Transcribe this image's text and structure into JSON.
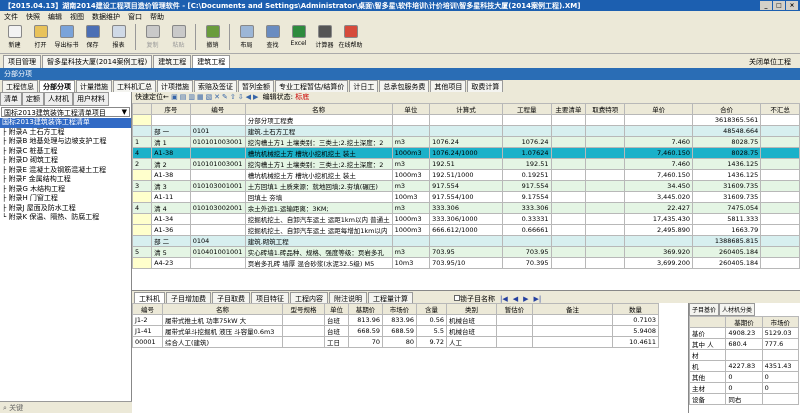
{
  "title": "【2015.04.13】湖南2014建设工程项目造价管理软件 - [C:\\Documents and Settings\\Administrator\\桌面\\智多星\\软件培训\\计价培训\\智多星科技大厦(2014案例工程).XM]",
  "window_controls": [
    "_",
    "□",
    "×"
  ],
  "menu": [
    "文件",
    "快照",
    "编辑",
    "视图",
    "数据维护",
    "窗口",
    "帮助"
  ],
  "toolbar": [
    {
      "label": "新建",
      "icon": "new-file-icon",
      "color": "#f3f3f3",
      "dis": false
    },
    {
      "label": "打开",
      "icon": "open-folder-icon",
      "color": "#e8c25a",
      "dis": false
    },
    {
      "label": "导出标书",
      "icon": "export-icon",
      "color": "#7aa3d9",
      "dis": false
    },
    {
      "label": "保存",
      "icon": "save-icon",
      "color": "#4b6fb5",
      "dis": false
    },
    {
      "label": "报表",
      "icon": "report-icon",
      "color": "#cfd9e6",
      "dis": false
    },
    {
      "label": "复制",
      "icon": "copy-icon",
      "color": "#c9c9c9",
      "dis": true
    },
    {
      "label": "粘贴",
      "icon": "paste-icon",
      "color": "#c9c9c9",
      "dis": true
    },
    {
      "label": "撤销",
      "icon": "undo-icon",
      "color": "#6a9c3c",
      "dis": false
    },
    {
      "label": "布局",
      "icon": "layout-icon",
      "color": "#9cb6d6",
      "dis": false
    },
    {
      "label": "查找",
      "icon": "find-icon",
      "color": "#6a8cc0",
      "dis": false
    },
    {
      "label": "Excel",
      "icon": "excel-icon",
      "color": "#2e8b3e",
      "dis": false
    },
    {
      "label": "计算器",
      "icon": "calculator-icon",
      "color": "#555",
      "dis": false
    },
    {
      "label": "在线帮助",
      "icon": "online-help-icon",
      "color": "#d64a3b",
      "dis": false
    }
  ],
  "top_tabs": [
    "项目管理",
    "智多星科技大厦(2014案例工程)",
    "建筑工程",
    "建筑工程"
  ],
  "top_right": [
    "关闭单位工程"
  ],
  "breadcrumb": "分部分项",
  "module_tabs": [
    "工程信息",
    "分部分项",
    "计量措施",
    "工料机汇总",
    "计项措施",
    "索赔及签证",
    "暂列金额",
    "专业工程暂估/结算价",
    "计日工",
    "总承包服务费",
    "其他项目",
    "取费计算"
  ],
  "left": {
    "tabs": [
      "清单",
      "定额",
      "人材机",
      "用户材料"
    ],
    "combo": "国标2013建筑装饰工程清单项目",
    "tree": [
      "国标2013建筑装饰工程清单",
      "├ 附录A 土石方工程",
      "├ 附录B 地基处理与边坡支护工程",
      "├ 附录C 桩基工程",
      "├ 附录D 砌筑工程",
      "├ 附录E 混凝土及钢筋混凝土工程",
      "├ 附录F 金属结构工程",
      "├ 附录G 木结构工程",
      "├ 附录H 门窗工程",
      "├ 附录J 屋面及防水工程",
      "└ 附录K 保温、隔热、防腐工程"
    ],
    "footer": "关键"
  },
  "grid_toolbar": {
    "locate": "快速定位←",
    "edit_state": "编辑状态:",
    "edit_value": "标底"
  },
  "grid_headers": [
    "",
    "序号",
    "编号",
    "名称",
    "单位",
    "计算式",
    "工程量",
    "主要清单",
    "取费特项",
    "单价",
    "合价",
    "不汇总"
  ],
  "rows": [
    {
      "t": "plain",
      "c": [
        "",
        "",
        "",
        "分部分项工程费",
        "",
        "",
        "",
        "",
        "",
        "",
        "3618365.561",
        ""
      ]
    },
    {
      "t": "div",
      "c": [
        "",
        "部 一",
        "0101",
        "建筑.土石方工程",
        "",
        "",
        "",
        "",
        "",
        "",
        "48548.664",
        ""
      ]
    },
    {
      "t": "qd",
      "c": [
        "1",
        "清 1",
        "010101003001",
        "挖沟槽土方1 土壤类别：三类土;2.挖土深度：2",
        "m3",
        "1076.24",
        "1076.24",
        "",
        "",
        "7.460",
        "8028.75",
        ""
      ]
    },
    {
      "t": "sel",
      "c": [
        "4",
        "A1-38",
        "",
        "槽坑机械挖土方 槽坑小挖机挖土 装土",
        "1000m3",
        "1076.24/1000",
        "1.07624",
        "",
        "",
        "7,460.150",
        "8028.75",
        ""
      ]
    },
    {
      "t": "qd",
      "c": [
        "2",
        "清 2",
        "010101003001",
        "挖沟槽土方1 土壤类别：三类土;2.挖土深度：2",
        "m3",
        "192.51",
        "192.51",
        "",
        "",
        "7.460",
        "1436.125",
        ""
      ]
    },
    {
      "t": "plain",
      "c": [
        "",
        "A1-38",
        "",
        "槽坑机械挖土方 槽坑小挖机挖土 装土",
        "1000m3",
        "192.51/1000",
        "0.19251",
        "",
        "",
        "7,460.150",
        "1436.125",
        ""
      ]
    },
    {
      "t": "qd",
      "c": [
        "3",
        "清 3",
        "010103001001",
        "土方回填1 土质来源：就地回填;2.夯填(碾压)",
        "m3",
        "917.554",
        "917.554",
        "",
        "",
        "34.450",
        "31609.735",
        ""
      ]
    },
    {
      "t": "plain",
      "c": [
        "",
        "A1-11",
        "",
        "回填土 夯填",
        "100m3",
        "917.554/100",
        "9.17554",
        "",
        "",
        "3,445.020",
        "31609.735",
        ""
      ]
    },
    {
      "t": "qd",
      "c": [
        "4",
        "清 4",
        "010103002001",
        "余土外运1.运输距离：3KM;",
        "m3",
        "333.306",
        "333.306",
        "",
        "",
        "22.427",
        "7475.054",
        ""
      ]
    },
    {
      "t": "plain",
      "c": [
        "",
        "A1-34",
        "",
        "挖掘机挖土、自卸汽车运土 运距1km以内 普通土",
        "1000m3",
        "333.306/1000",
        "0.33331",
        "",
        "",
        "17,435.430",
        "5811.333",
        ""
      ]
    },
    {
      "t": "plain",
      "c": [
        "",
        "A1-36",
        "",
        "挖掘机挖土、自卸汽车运土 运距每增加1km以内",
        "1000m3",
        "666.612/1000",
        "0.66661",
        "",
        "",
        "2,495.890",
        "1663.79",
        ""
      ]
    },
    {
      "t": "div",
      "c": [
        "",
        "部 二",
        "0104",
        "建筑.砌筑工程",
        "",
        "",
        "",
        "",
        "",
        "",
        "1388685.815",
        ""
      ]
    },
    {
      "t": "qd",
      "c": [
        "5",
        "清 5",
        "010401001001",
        "实心砖墙1.砖品种、规格、强度等级：页岩多孔",
        "m3",
        "703.95",
        "703.95",
        "",
        "",
        "369.920",
        "260405.184",
        ""
      ]
    },
    {
      "t": "plain",
      "c": [
        "",
        "A4-23",
        "",
        "页岩多孔砖 墙厚 混合砂浆(水泥32.5级) M5",
        "10m3",
        "703.95/10",
        "70.395",
        "",
        "",
        "3,699.200",
        "260405.184",
        ""
      ]
    }
  ],
  "low_tabs": [
    "工料机",
    "子目增加费",
    "子目取费",
    "项目特征",
    "工程内容",
    "附注说明",
    "工程量计算"
  ],
  "low_extra": {
    "detail": "锁子目名称",
    "nav": [
      "|◀",
      "◀",
      "▶",
      "▶|"
    ]
  },
  "low_headers": [
    "编号",
    "名称",
    "型号规格",
    "单位",
    "基期价",
    "市场价",
    "含量",
    "类别",
    "暂估价",
    "备注",
    "数量"
  ],
  "low_rows": [
    [
      "J1-2",
      "履带式推土机 功率75kW 大",
      "",
      "台班",
      "813.96",
      "833.96",
      "0.56",
      "机械台班",
      "",
      "",
      "0.7103"
    ],
    [
      "J1-41",
      "履带式单斗挖掘机 液压 斗容量0.6m3",
      "",
      "台班",
      "668.59",
      "688.59",
      "5.5",
      "机械台班",
      "",
      "",
      "5.9408"
    ],
    [
      "00001",
      "综合人工(建筑)",
      "",
      "工日",
      "70",
      "80",
      "9.72",
      "人工",
      "",
      "",
      "10.4611"
    ]
  ],
  "right_tabs": [
    "子目基价",
    "人材机分类"
  ],
  "right_headers": [
    "",
    "基期价",
    "市场价"
  ],
  "right_rows": [
    [
      "基价",
      "4908.23",
      "5129.03"
    ],
    [
      "其中 人",
      "680.4",
      "777.6"
    ],
    [
      "材",
      "",
      ""
    ],
    [
      "机",
      "4227.83",
      "4351.43"
    ],
    [
      "其他",
      "0",
      "0"
    ],
    [
      "主材",
      "0",
      "0"
    ],
    [
      "设备",
      "同右",
      ""
    ]
  ]
}
